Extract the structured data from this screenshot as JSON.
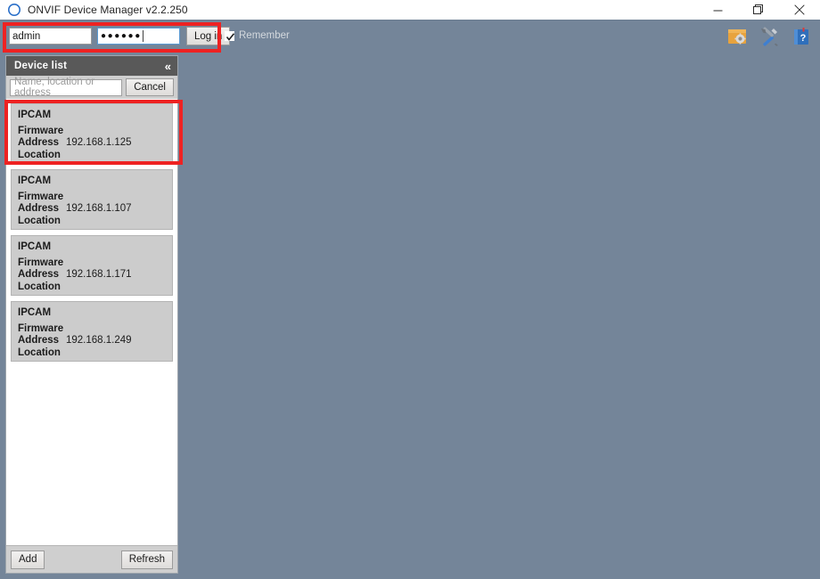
{
  "window": {
    "title": "ONVIF Device Manager v2.2.250",
    "logo_icon": "onvif-ring-logo",
    "controls": {
      "minimize": "minimize-icon",
      "maximize": "maximize-icon",
      "close": "close-icon"
    }
  },
  "toolbar": {
    "username": "admin",
    "username_placeholder": "",
    "password_masked": "●●●●●●",
    "login_label": "Log in",
    "remember_label": "Remember",
    "remember_checked": true,
    "icons": [
      {
        "name": "folder-settings-icon",
        "title": ""
      },
      {
        "name": "tools-icon",
        "title": ""
      },
      {
        "name": "help-book-icon",
        "title": ""
      }
    ]
  },
  "device_panel": {
    "header_title": "Device list",
    "collapse_icon": "chevron-double-left-icon",
    "search_placeholder": "Name, location or address",
    "search_value": "",
    "cancel_label": "Cancel",
    "add_label": "Add",
    "refresh_label": "Refresh",
    "field_labels": {
      "firmware": "Firmware",
      "address": "Address",
      "location": "Location"
    },
    "devices": [
      {
        "name": "IPCAM",
        "firmware": "",
        "address": "192.168.1.125",
        "location": "",
        "selected": true
      },
      {
        "name": "IPCAM",
        "firmware": "",
        "address": "192.168.1.107",
        "location": "",
        "selected": false
      },
      {
        "name": "IPCAM",
        "firmware": "",
        "address": "192.168.1.171",
        "location": "",
        "selected": false
      },
      {
        "name": "IPCAM",
        "firmware": "",
        "address": "192.168.1.249",
        "location": "",
        "selected": false
      }
    ]
  },
  "annotations": [
    {
      "name": "login-highlight",
      "color": "#ee2222"
    },
    {
      "name": "selected-device-highlight",
      "color": "#ee2222"
    }
  ],
  "colors": {
    "app_background": "#748599",
    "panel_header": "#595959",
    "card": "#cccccc",
    "annotation": "#ee2222"
  }
}
